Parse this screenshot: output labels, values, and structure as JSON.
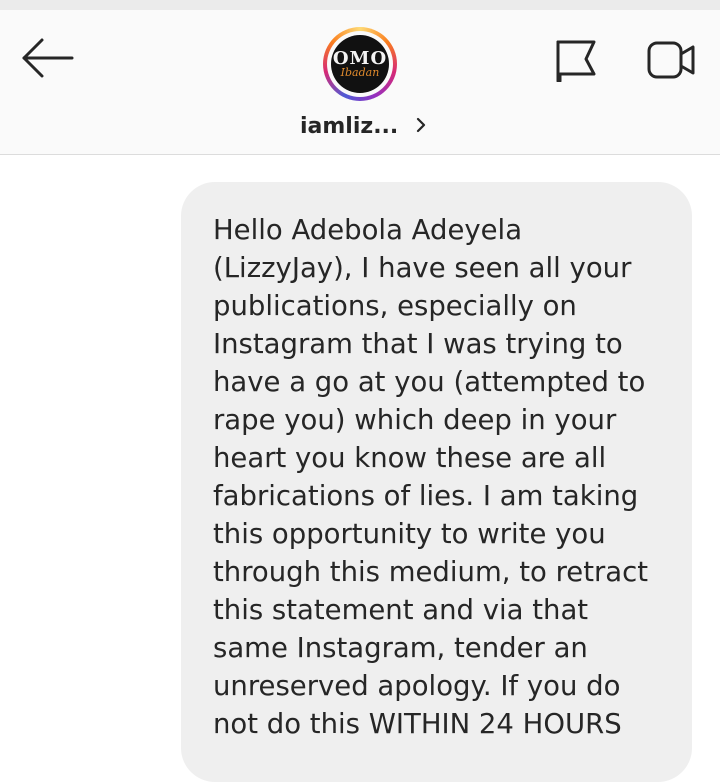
{
  "header": {
    "username": "iamliz...",
    "avatar_logo_main": "OMO",
    "avatar_logo_sub": "Ibadan",
    "icons": {
      "back": "arrow-left-icon",
      "flag": "flag-icon",
      "video": "video-camera-icon",
      "chevron": "chevron-right-icon"
    }
  },
  "message": {
    "text": "Hello Adebola Adeyela\n(LizzyJay), I have seen all  your\npublications, especially on\nInstagram that I was trying to\nhave a go at you (attempted to\nrape you) which deep in your\nheart you know these are all\nfabrications of lies. I am taking\nthis opportunity to write you\nthrough this medium, to retract\nthis statement and via that\nsame Instagram, tender an\nunreserved apology. If you do\nnot do this WITHIN 24 HOURS"
  },
  "colors": {
    "header_bg": "#fafafa",
    "bubble_bg": "#efefef",
    "text": "#262626",
    "icon": "#262626"
  }
}
